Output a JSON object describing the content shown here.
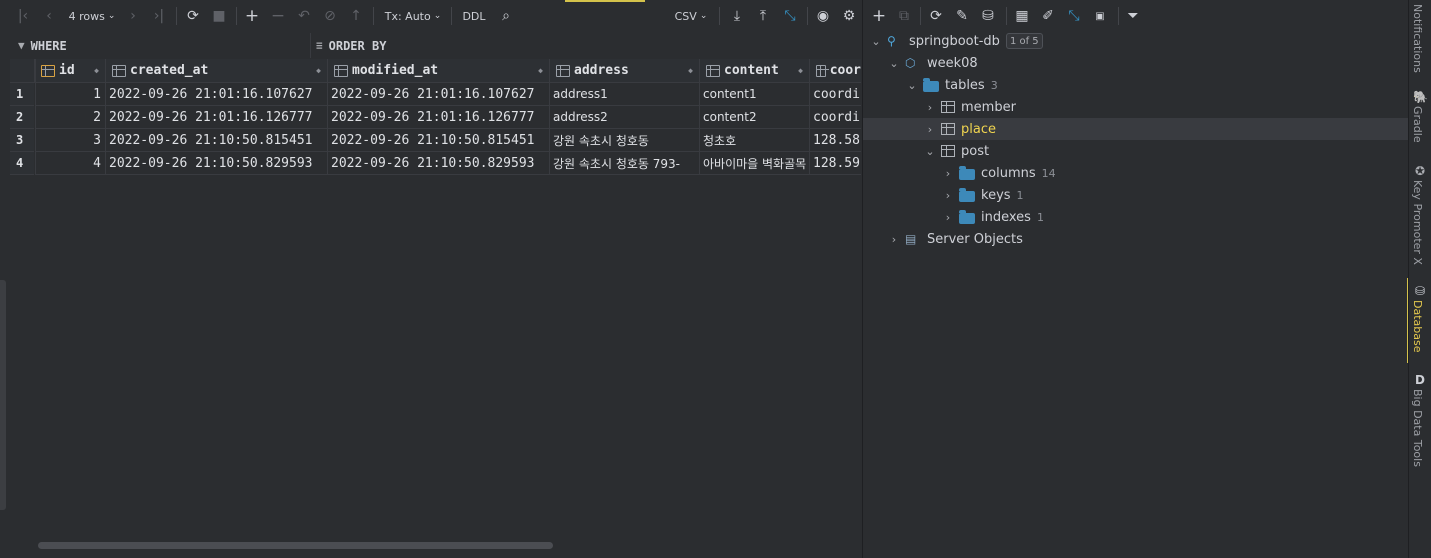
{
  "toolbar": {
    "rows_label": "4 rows",
    "tx_label": "Tx: Auto",
    "ddl_label": "DDL",
    "export_format": "CSV"
  },
  "filter": {
    "where_label": "WHERE",
    "orderby_label": "ORDER BY"
  },
  "grid": {
    "columns": [
      "id",
      "created_at",
      "modified_at",
      "address",
      "content",
      "coor"
    ],
    "rows": [
      {
        "num": "1",
        "id": "1",
        "created_at": "2022-09-26 21:01:16.107627",
        "modified_at": "2022-09-26 21:01:16.107627",
        "address": "address1",
        "content": "content1",
        "coor": "coordi"
      },
      {
        "num": "2",
        "id": "2",
        "created_at": "2022-09-26 21:01:16.126777",
        "modified_at": "2022-09-26 21:01:16.126777",
        "address": "address2",
        "content": "content2",
        "coor": "coordi"
      },
      {
        "num": "3",
        "id": "3",
        "created_at": "2022-09-26 21:10:50.815451",
        "modified_at": "2022-09-26 21:10:50.815451",
        "address": "강원 속초시 청호동",
        "content": "청초호",
        "coor": "128.58"
      },
      {
        "num": "4",
        "id": "4",
        "created_at": "2022-09-26 21:10:50.829593",
        "modified_at": "2022-09-26 21:10:50.829593",
        "address": "강원 속초시 청호동 793-",
        "content": "아바이마을 벽화골목",
        "coor": "128.59"
      }
    ]
  },
  "tree": {
    "datasource": "springboot-db",
    "datasource_badge": "1 of 5",
    "schema": "week08",
    "tables_label": "tables",
    "tables_count": "3",
    "tables": [
      "member",
      "place",
      "post"
    ],
    "post_children": [
      {
        "label": "columns",
        "count": "14"
      },
      {
        "label": "keys",
        "count": "1"
      },
      {
        "label": "indexes",
        "count": "1"
      }
    ],
    "server_objects": "Server Objects"
  },
  "stripe": {
    "notifications": "Notifications",
    "gradle": "Gradle",
    "key_promoter": "Key Promoter X",
    "database": "Database",
    "big_data": "Big Data Tools"
  },
  "colors": {
    "accent": "#d4c24b",
    "folder": "#3d89b9",
    "selected_table": "#f0d44f"
  }
}
